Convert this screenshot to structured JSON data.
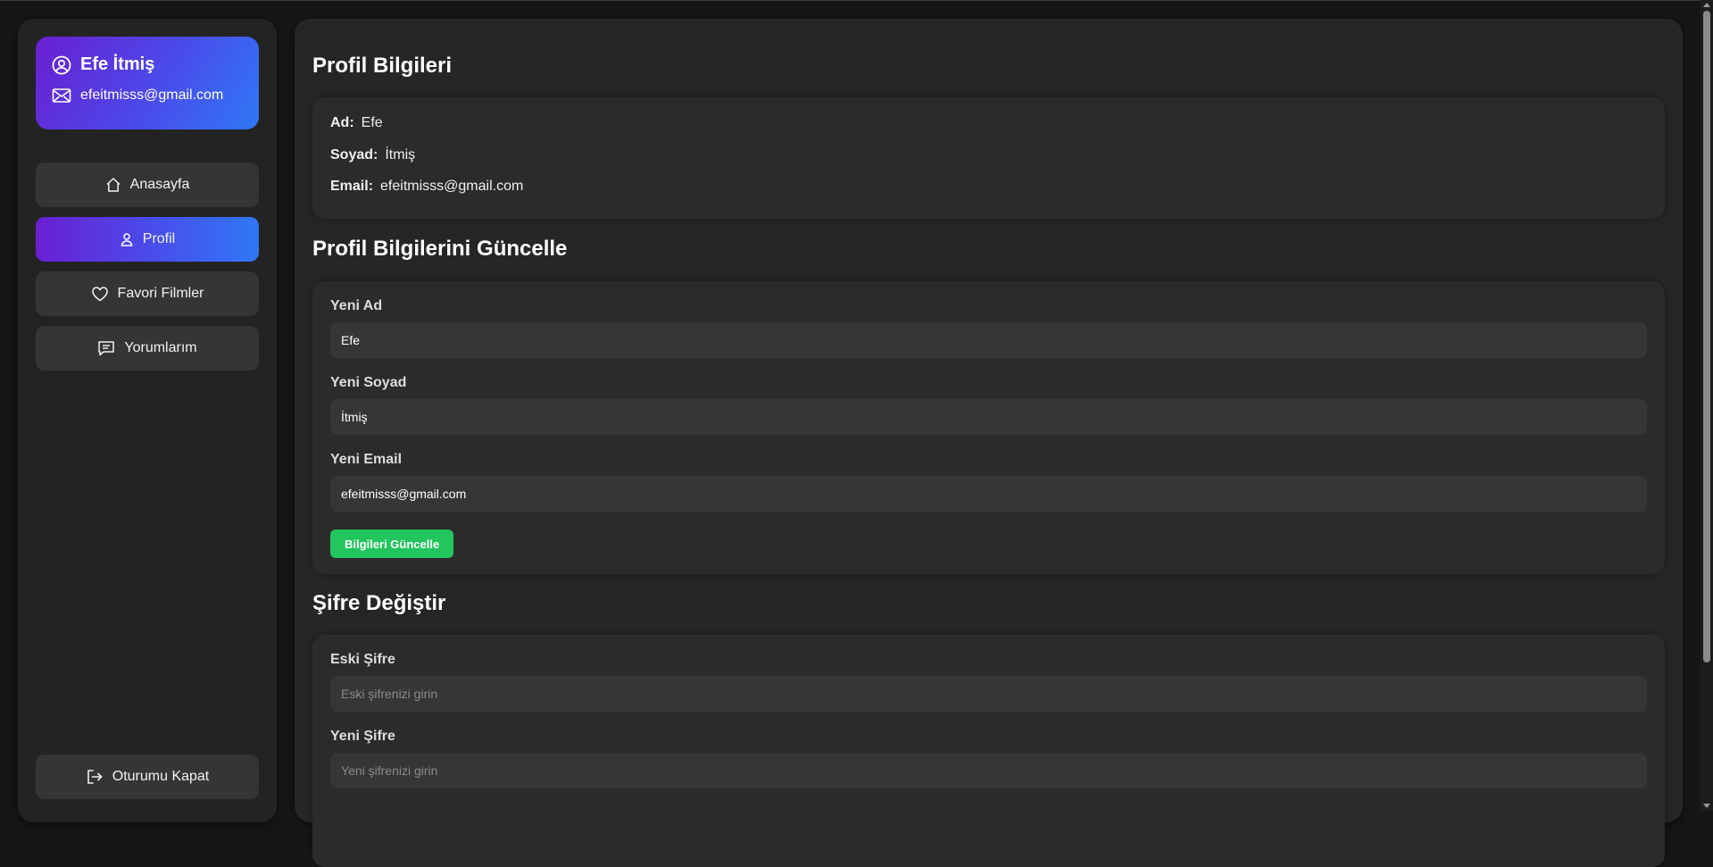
{
  "sidebar": {
    "user": {
      "name": "Efe İtmiş",
      "email": "efeitmisss@gmail.com"
    },
    "nav": {
      "home": "Anasayfa",
      "profile": "Profil",
      "favorites": "Favori Filmler",
      "comments": "Yorumlarım"
    },
    "logout": "Oturumu Kapat"
  },
  "profile_info": {
    "title": "Profil Bilgileri",
    "first_name_label": "Ad:",
    "first_name": "Efe",
    "last_name_label": "Soyad:",
    "last_name": "İtmiş",
    "email_label": "Email:",
    "email": "efeitmisss@gmail.com"
  },
  "update_form": {
    "title": "Profil Bilgilerini Güncelle",
    "new_name_label": "Yeni Ad",
    "new_name_value": "Efe",
    "new_surname_label": "Yeni Soyad",
    "new_surname_value": "İtmiş",
    "new_email_label": "Yeni Email",
    "new_email_value": "efeitmisss@gmail.com",
    "submit": "Bilgileri Güncelle"
  },
  "password_form": {
    "title": "Şifre Değiştir",
    "old_label": "Eski Şifre",
    "old_placeholder": "Eski şifrenizi girin",
    "new_label": "Yeni Şifre",
    "new_placeholder": "Yeni şifrenizi girin"
  },
  "colors": {
    "accent_gradient_start": "#6a1fd1",
    "accent_gradient_end": "#2f78f6",
    "success": "#22c55e",
    "background": "#161616"
  }
}
